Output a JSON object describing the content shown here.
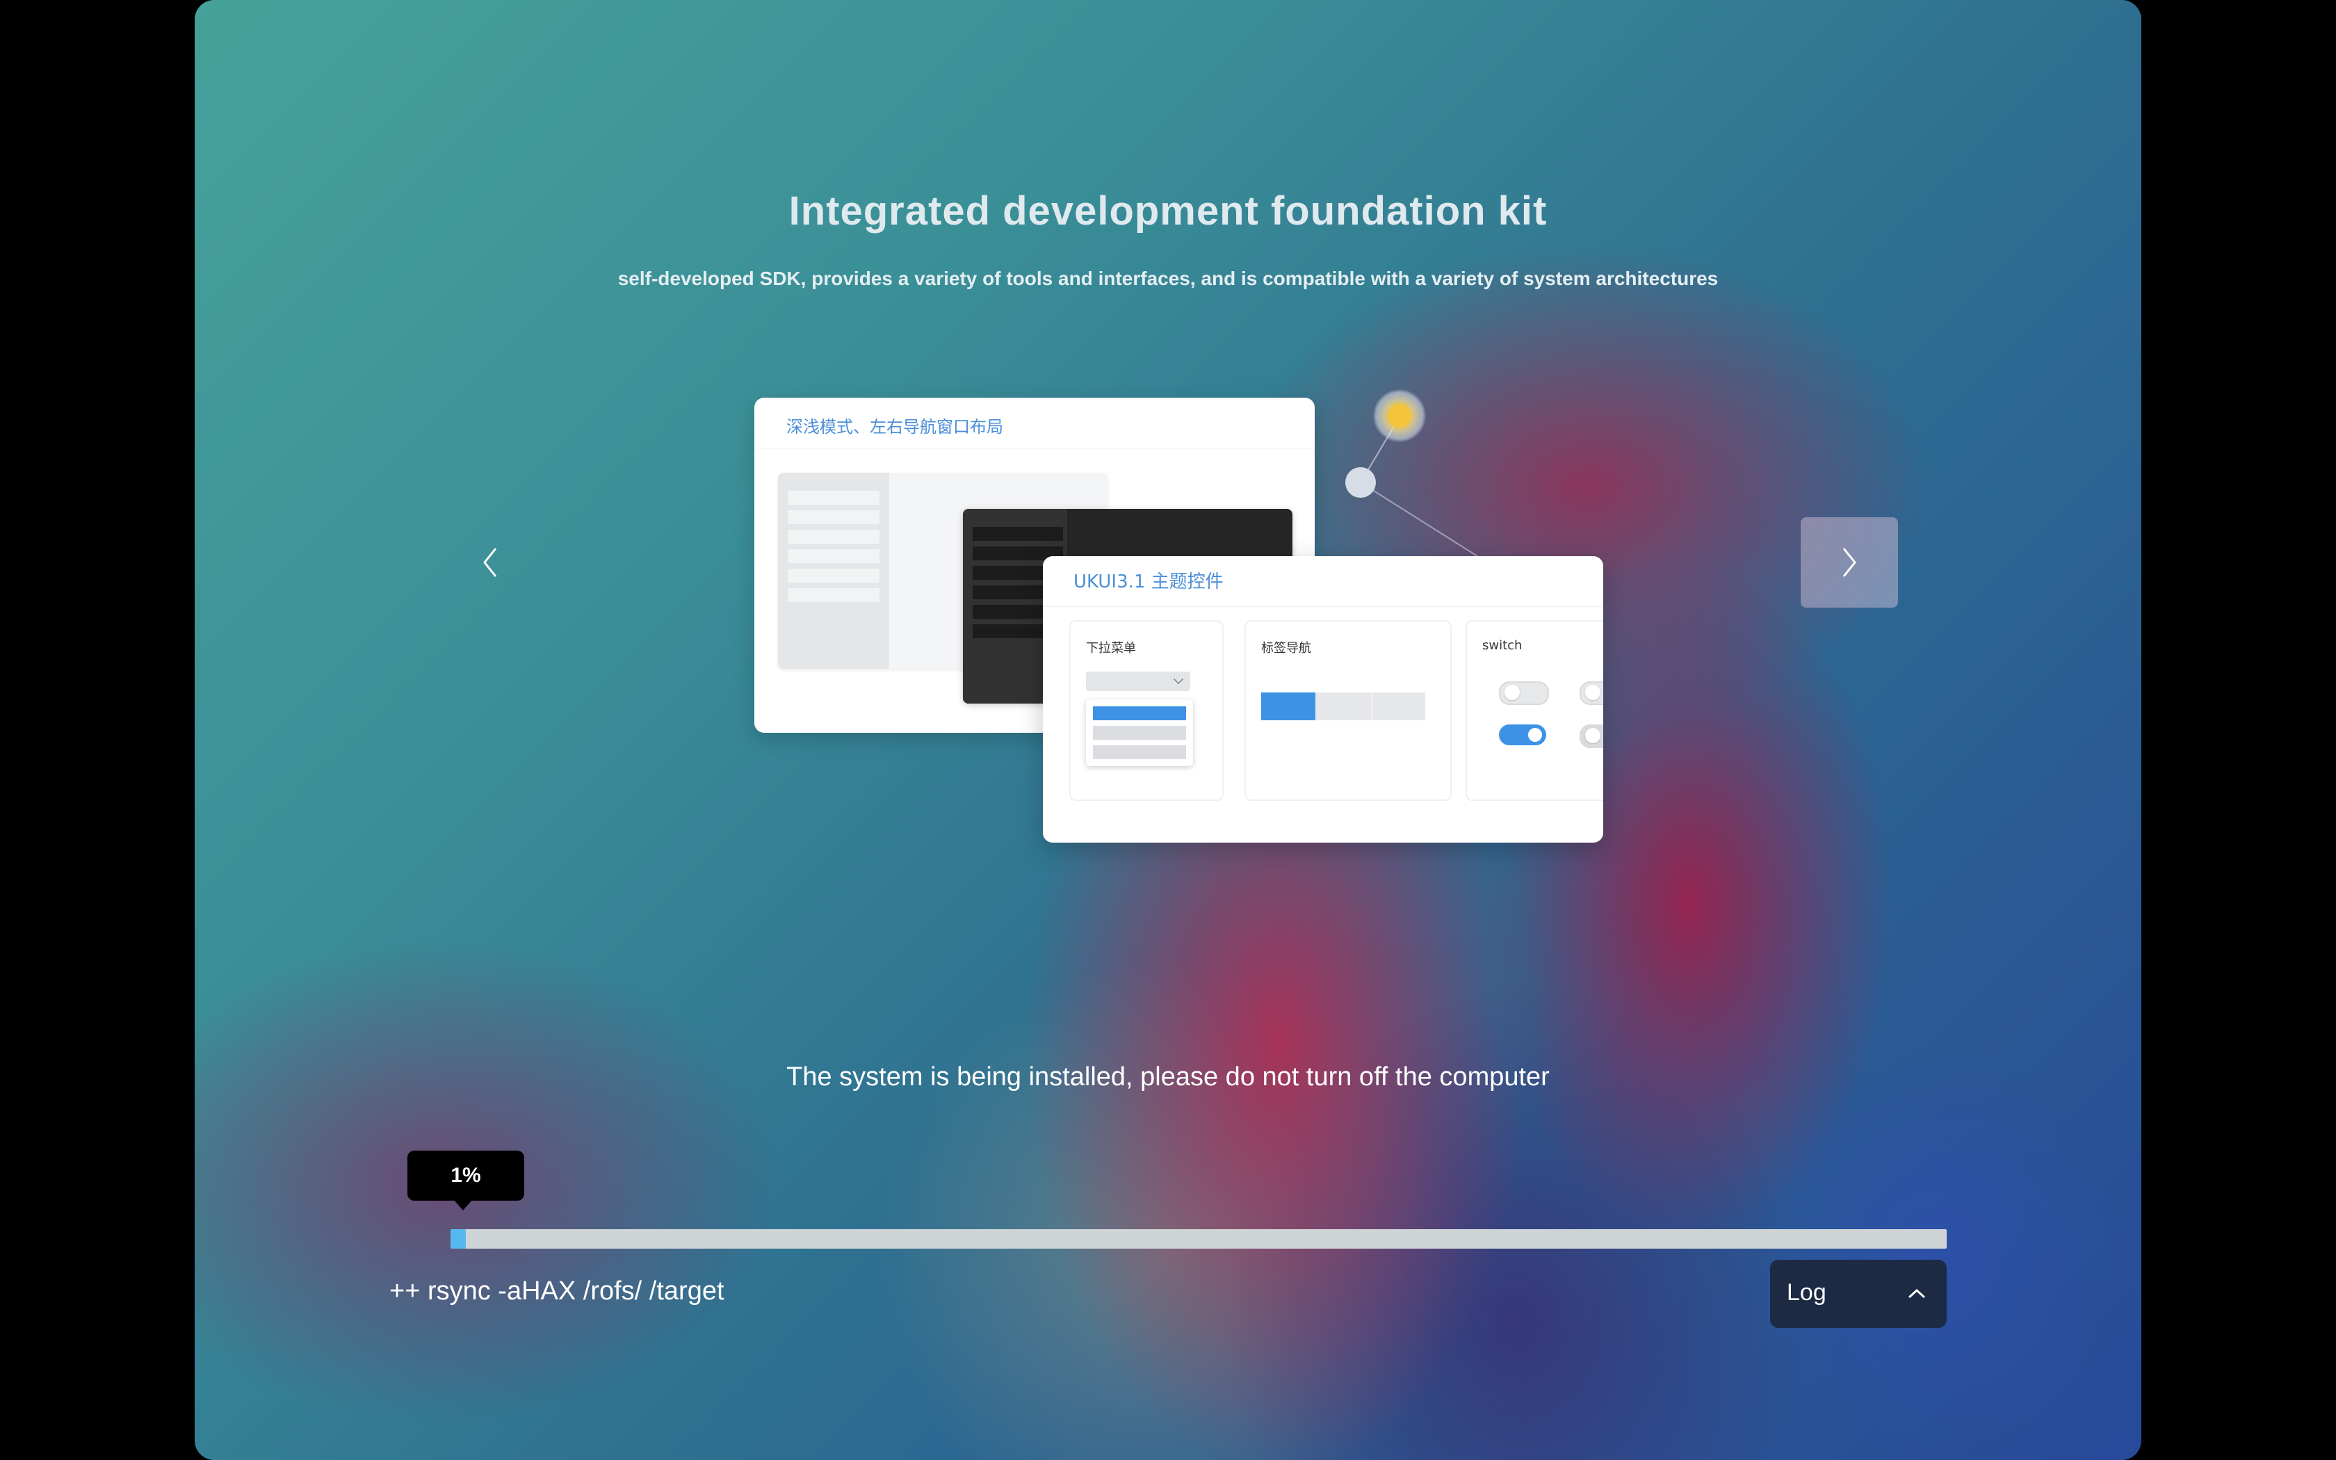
{
  "slide": {
    "title": "Integrated development foundation kit",
    "subtitle": "self-developed SDK, provides a variety of tools and interfaces, and is compatible with a variety of system architectures",
    "illustration": {
      "card_a_title": "深浅模式、左右导航窗口布局",
      "card_b_title": "UKUI3.1 主题控件",
      "panel_dropdown_label": "下拉菜单",
      "panel_tabnav_label": "标签导航",
      "panel_switch_label": "switch"
    }
  },
  "nav": {
    "prev_icon": "chevron-left-icon",
    "next_icon": "chevron-right-icon"
  },
  "install": {
    "status_text": "The system is being installed, please do not turn off the computer",
    "progress_percent": 1,
    "progress_label": "1%",
    "log_line": "++ rsync -aHAX /rofs/ /target",
    "log_button_label": "Log",
    "log_button_icon": "chevron-up-icon"
  },
  "colors": {
    "accent_blue": "#3d92e6",
    "progress_fill": "#57b8f0",
    "log_button_bg": "#1d2a44"
  }
}
